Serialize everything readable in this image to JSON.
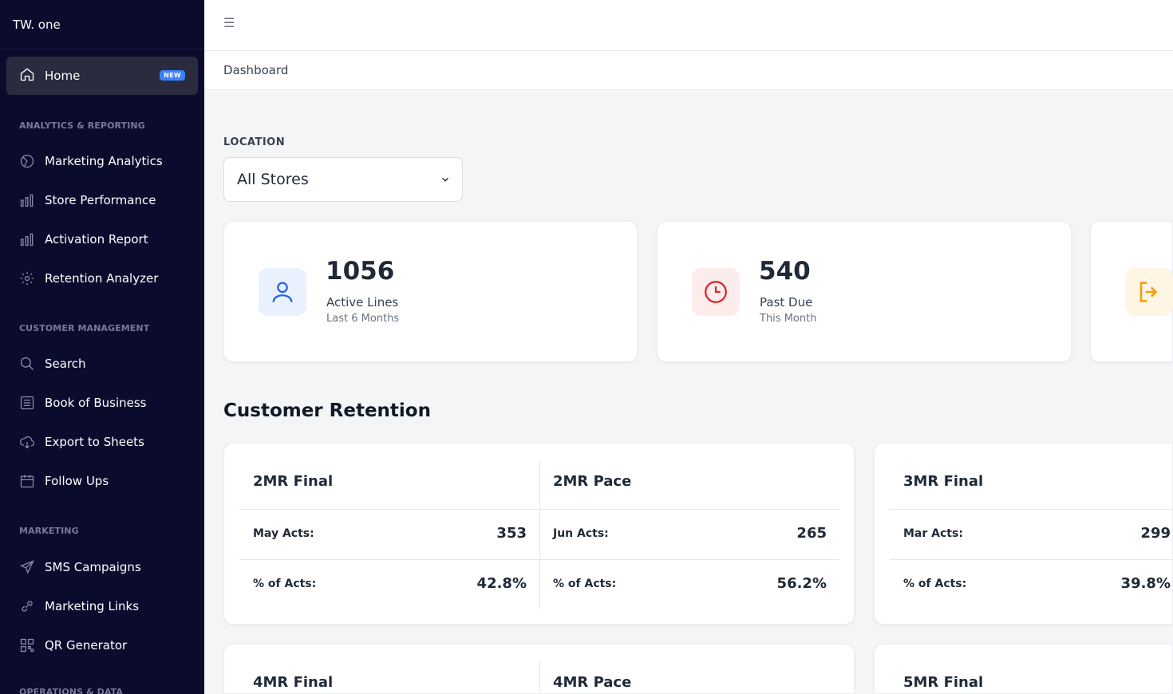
{
  "app": {
    "brand": "TW. one"
  },
  "sidebar": {
    "home": {
      "label": "Home",
      "badge": "NEW"
    },
    "sections": [
      {
        "title": "ANALYTICS & REPORTING",
        "items": [
          {
            "label": "Marketing Analytics",
            "icon": "pie-chart-icon"
          },
          {
            "label": "Store Performance",
            "icon": "bar-chart-icon"
          },
          {
            "label": "Activation Report",
            "icon": "bar-chart-icon"
          },
          {
            "label": "Retention Analyzer",
            "icon": "gear-icon"
          }
        ]
      },
      {
        "title": "CUSTOMER MANAGEMENT",
        "items": [
          {
            "label": "Search",
            "icon": "search-icon"
          },
          {
            "label": "Book of Business",
            "icon": "list-icon"
          },
          {
            "label": "Export to Sheets",
            "icon": "cloud-download-icon"
          },
          {
            "label": "Follow Ups",
            "icon": "calendar-icon"
          }
        ]
      },
      {
        "title": "MARKETING",
        "items": [
          {
            "label": "SMS Campaigns",
            "icon": "send-icon"
          },
          {
            "label": "Marketing Links",
            "icon": "link-icon"
          },
          {
            "label": "QR Generator",
            "icon": "qr-icon"
          }
        ]
      },
      {
        "title": "OPERATIONS & DATA",
        "items": []
      }
    ]
  },
  "breadcrumb": "Dashboard",
  "location": {
    "label": "LOCATION",
    "selected": "All Stores"
  },
  "stats": [
    {
      "value": "1056",
      "label": "Active Lines",
      "sub": "Last 6 Months",
      "icon": "user-icon",
      "color": "#2563eb",
      "bg": "#eaf1fe"
    },
    {
      "value": "540",
      "label": "Past Due",
      "sub": "This Month",
      "icon": "clock-icon",
      "color": "#dc2626",
      "bg": "#fdecec"
    },
    {
      "value": "",
      "label": "",
      "sub": "",
      "icon": "logout-icon",
      "color": "#f59e0b",
      "bg": "#fef5e4"
    }
  ],
  "retention": {
    "heading": "Customer Retention",
    "cards": [
      {
        "cols": [
          {
            "title": "2MR Final",
            "rows": [
              {
                "k": "May Acts:",
                "v": "353"
              },
              {
                "k": "% of Acts:",
                "v": "42.8%"
              }
            ]
          },
          {
            "title": "2MR Pace",
            "rows": [
              {
                "k": "Jun Acts:",
                "v": "265"
              },
              {
                "k": "% of Acts:",
                "v": "56.2%"
              }
            ]
          }
        ]
      },
      {
        "cols": [
          {
            "title": "3MR Final",
            "rows": [
              {
                "k": "Mar Acts:",
                "v": "299"
              },
              {
                "k": "% of Acts:",
                "v": "39.8%"
              }
            ]
          }
        ]
      },
      {
        "cols": [
          {
            "title": "4MR Final",
            "rows": []
          },
          {
            "title": "4MR Pace",
            "rows": []
          }
        ]
      },
      {
        "cols": [
          {
            "title": "5MR Final",
            "rows": []
          }
        ]
      }
    ]
  }
}
